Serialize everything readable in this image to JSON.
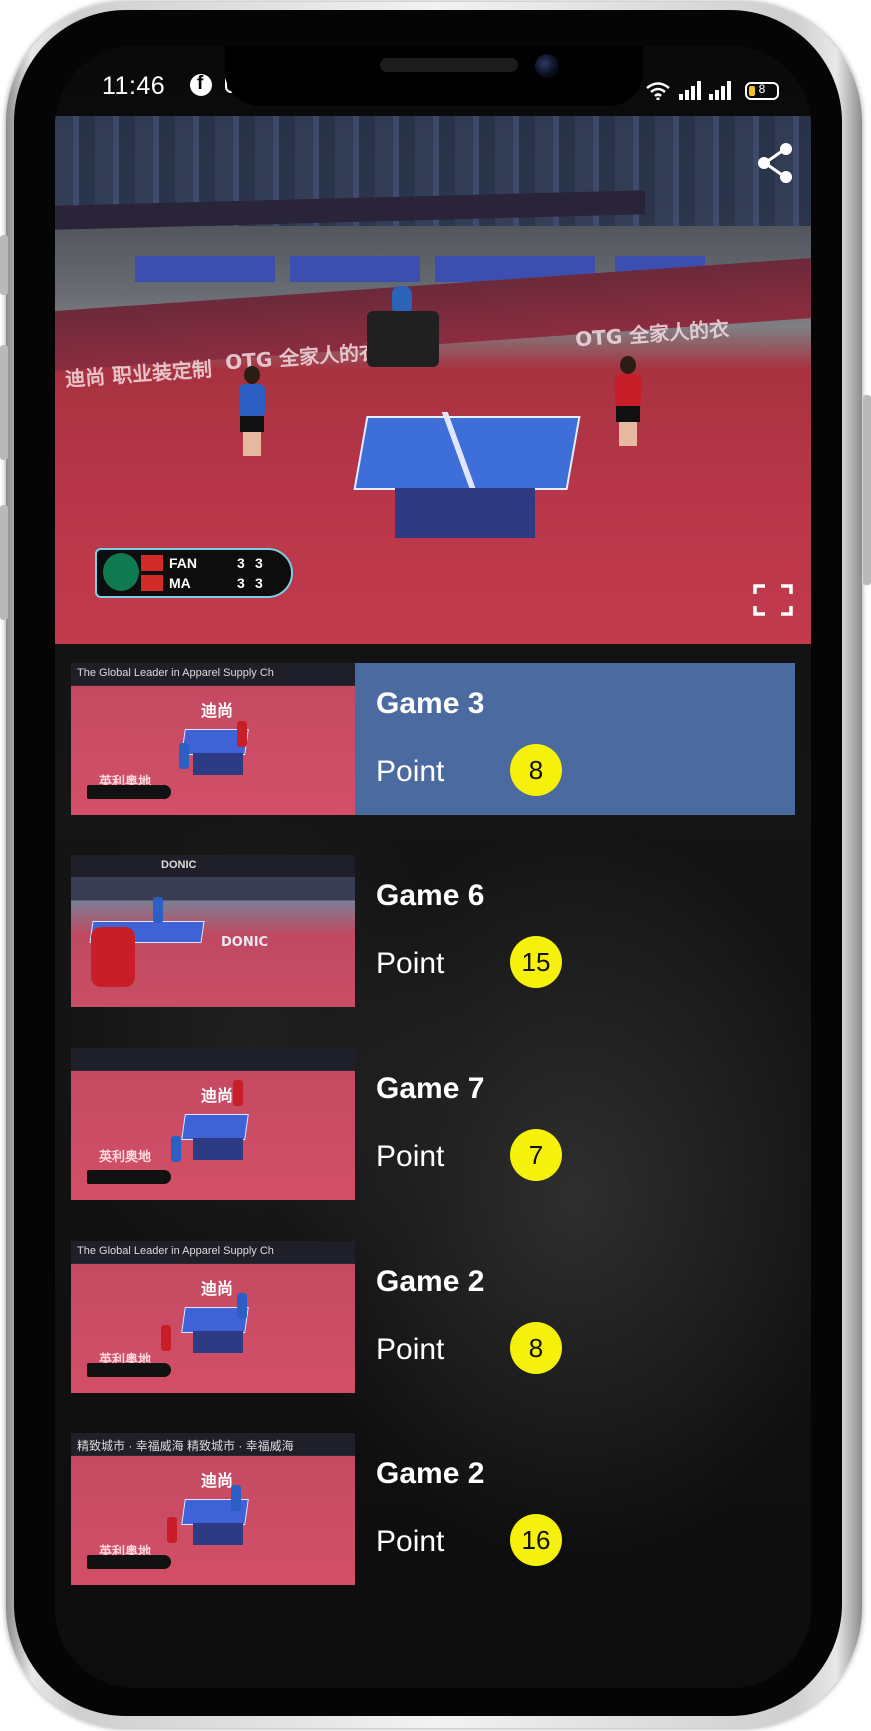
{
  "status_bar": {
    "time": "11:46",
    "battery": "8",
    "icons": [
      "facebook-icon",
      "app-icon",
      "wifi-icon",
      "signal-icon",
      "battery-icon"
    ]
  },
  "video": {
    "scoreboard": {
      "players": [
        {
          "name": "FAN",
          "scores": [
            "3",
            "3"
          ]
        },
        {
          "name": "MA",
          "scores": [
            "3",
            "3"
          ]
        }
      ]
    },
    "controls": [
      "share-icon",
      "fullscreen-icon"
    ]
  },
  "clips": [
    {
      "title": "Game 3",
      "point_label": "Point",
      "point": "8",
      "active": true,
      "thumb_banner": "The Global Leader in Apparel Supply Ch"
    },
    {
      "title": "Game 6",
      "point_label": "Point",
      "point": "15",
      "active": false,
      "thumb_banner": "DONIC"
    },
    {
      "title": "Game 7",
      "point_label": "Point",
      "point": "7",
      "active": false,
      "thumb_banner": ""
    },
    {
      "title": "Game 2",
      "point_label": "Point",
      "point": "8",
      "active": false,
      "thumb_banner": "The Global Leader in Apparel Supply Ch"
    },
    {
      "title": "Game 2",
      "point_label": "Point",
      "point": "16",
      "active": false,
      "thumb_banner": "精致城市 · 幸福威海  精致城市 · 幸福威海"
    }
  ],
  "colors": {
    "active_row": "#4a6aa0",
    "point_badge": "#f5f10a",
    "background": "#111111"
  }
}
